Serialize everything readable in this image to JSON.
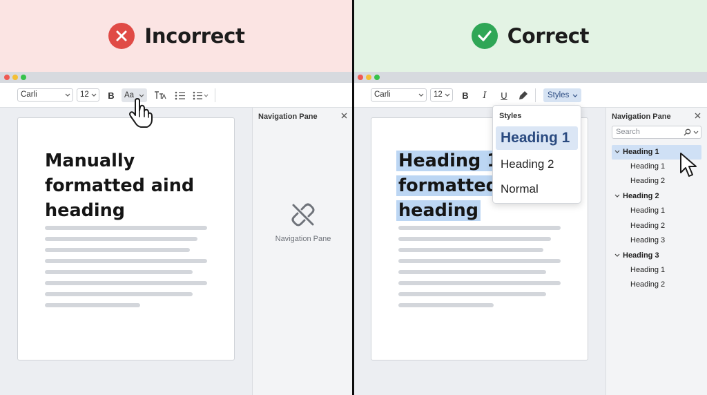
{
  "incorrect": {
    "banner": {
      "title": "Incorrect",
      "icon": "x-circle-icon",
      "color": "#e04b46"
    },
    "toolbar": {
      "font": "Carli",
      "size": "12",
      "bold": "B",
      "case_button": "Aa"
    },
    "document": {
      "heading_lines": [
        "Manually",
        "formatted aind",
        "heading"
      ]
    },
    "nav_pane": {
      "title": "Navigation Pane",
      "empty_label": "Navigation Pane"
    }
  },
  "correct": {
    "banner": {
      "title": "Correct",
      "icon": "check-circle-icon",
      "color": "#2fa656"
    },
    "toolbar": {
      "font": "Carli",
      "size": "12",
      "bold": "B",
      "italic": "I",
      "underline": "U",
      "styles_button": "Styles"
    },
    "styles_menu": {
      "title": "Styles",
      "items": [
        "Heading 1",
        "Heading 2",
        "Normal"
      ],
      "selected": "Heading 1"
    },
    "document": {
      "heading_lines": [
        "Heading 1",
        "formatted",
        "heading"
      ]
    },
    "nav_pane": {
      "title": "Navigation Pane",
      "search_placeholder": "Search",
      "tree": [
        {
          "label": "Heading 1",
          "children": [
            "Heading 1",
            "Heading 2"
          ]
        },
        {
          "label": "Heading 2",
          "children": [
            "Heading 1",
            "Heading 2",
            "Heading 3"
          ]
        },
        {
          "label": "Heading 3",
          "children": [
            "Heading 1",
            "Heading 2"
          ]
        }
      ]
    }
  }
}
